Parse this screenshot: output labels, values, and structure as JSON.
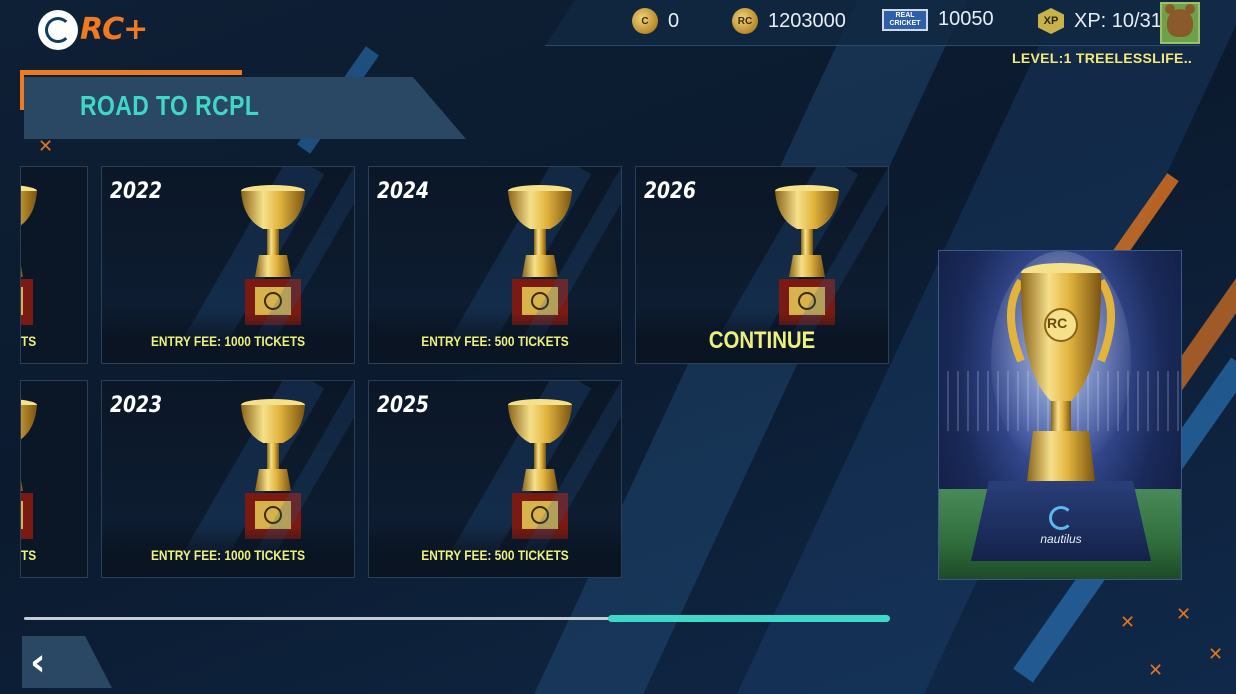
{
  "header": {
    "logo_name": "nautilus",
    "app_badge": "RC+",
    "stats": {
      "currency_c": "0",
      "coins": "1203000",
      "tickets": "10050",
      "xp": "XP: 10/310"
    },
    "ticket_label": "REAL CRICKET",
    "coin_label": "RC",
    "xp_label": "XP",
    "level_text": "LEVEL:1 TREELESSLIFE.."
  },
  "page_title": "ROAD TO RCPL",
  "partial_cards": [
    {
      "label": "TS"
    },
    {
      "label": "TS"
    }
  ],
  "cards": [
    {
      "year": "2022",
      "label": "ENTRY FEE: 1000 TICKETS",
      "style": "fee"
    },
    {
      "year": "2024",
      "label": "ENTRY FEE: 500 TICKETS",
      "style": "fee"
    },
    {
      "year": "2026",
      "label": "CONTINUE",
      "style": "continue"
    },
    {
      "year": "2023",
      "label": "ENTRY FEE: 1000 TICKETS",
      "style": "fee"
    },
    {
      "year": "2025",
      "label": "ENTRY FEE: 500 TICKETS",
      "style": "fee"
    }
  ],
  "feature_trophy": {
    "badge": "RC",
    "pedestal_brand": "nautilus"
  },
  "scroll": {
    "position": 0.7,
    "visible_fraction": 0.33
  },
  "colors": {
    "accent_orange": "#f07a22",
    "accent_teal": "#3fd8c8",
    "label_yellow": "#eef07a",
    "background": "#0b1a2e"
  },
  "icons": [
    "c-coin-icon",
    "rc-coin-icon",
    "ticket-icon",
    "xp-icon",
    "avatar-bear",
    "back-arrow-icon",
    "trophy-icon"
  ]
}
